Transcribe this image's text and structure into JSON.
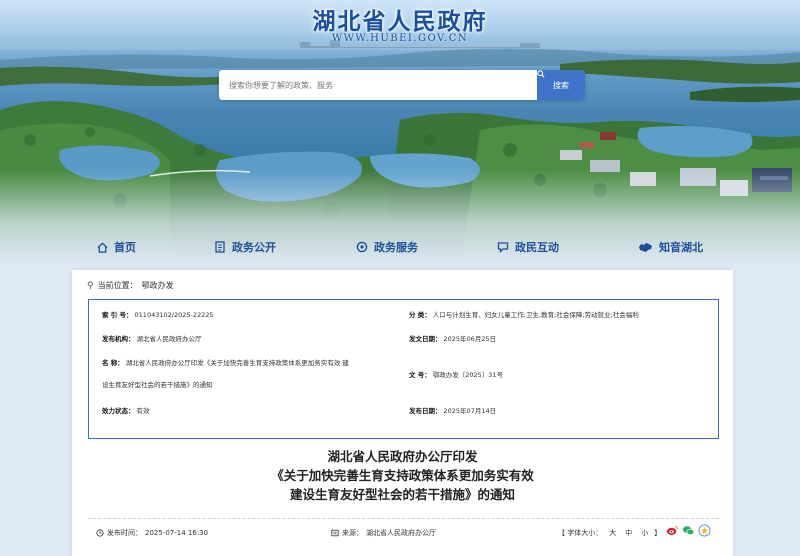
{
  "header": {
    "site_title": "湖北省人民政府",
    "site_url": "WWW.HUBEI.GOV.CN"
  },
  "search": {
    "placeholder": "搜索你想要了解的政策、服务",
    "button_label": "搜索"
  },
  "nav": {
    "items": [
      {
        "label": "首页",
        "icon": "home-icon"
      },
      {
        "label": "政务公开",
        "icon": "document-icon"
      },
      {
        "label": "政务服务",
        "icon": "service-icon"
      },
      {
        "label": "政民互动",
        "icon": "interaction-icon"
      },
      {
        "label": "知音湖北",
        "icon": "hubei-map-icon"
      }
    ]
  },
  "breadcrumb": {
    "prefix": "当前位置：",
    "current": "鄂政办发"
  },
  "meta": {
    "index_label": "索 引 号：",
    "index_value": "011043102/2025-22225",
    "category_label": "分      类：",
    "category_value": "人口与计划生育、妇女儿童工作;卫生;教育;社会保障;劳动就业;社会福利",
    "issuer_label": "发布机构：",
    "issuer_value": "湖北省人民政府办公厅",
    "date_issued_label": "发文日期：",
    "date_issued_value": "2025年06月25日",
    "name_label": "名      称：",
    "name_value_line1": "湖北省人民政府办公厅印发《关于加快完善生育支持政策体系更加务实有效 建",
    "name_value_line2": "设生育友好型社会的若干措施》的通知",
    "doc_no_label": "文      号：",
    "doc_no_value": "鄂政办发〔2025〕31号",
    "validity_label": "效力状态：",
    "validity_value": "有效",
    "publish_date_label": "发布日期：",
    "publish_date_value": "2025年07月14日"
  },
  "document": {
    "title_line1": "湖北省人民政府办公厅印发",
    "title_line2": "《关于加快完善生育支持政策体系更加务实有效",
    "title_line3": "建设生育友好型社会的若干措施》的通知"
  },
  "footer": {
    "publish_time_label": "发布时间：",
    "publish_time_value": "2025-07-14 16:30",
    "source_label": "来源：",
    "source_value": "湖北省人民政府办公厅",
    "font_size_prefix": "【 字体大小：",
    "font_large": "大",
    "font_medium": "中",
    "font_small": "小",
    "font_size_suffix": "】"
  },
  "colors": {
    "brand_blue": "#1d4f9a",
    "search_button": "#3f73c9",
    "meta_border": "#3a6fbf",
    "weibo": "#e6162d",
    "wechat": "#2aae67"
  }
}
